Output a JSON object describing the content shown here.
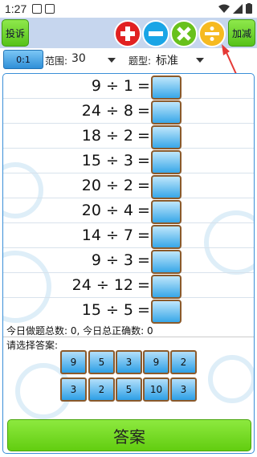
{
  "status_bar": {
    "time": "1:27"
  },
  "toolbar": {
    "complain_label": "投诉",
    "add_sub_label": "加减",
    "operators": [
      "plus",
      "minus",
      "times",
      "divide"
    ]
  },
  "settings": {
    "range_button_label": "0:1",
    "range_label": "范围:",
    "range_value": "30",
    "type_label": "题型:",
    "type_value": "标准"
  },
  "problems": [
    {
      "expr": "9 ÷ 1",
      "eq": "="
    },
    {
      "expr": "24 ÷ 8",
      "eq": "="
    },
    {
      "expr": "18 ÷ 2",
      "eq": "="
    },
    {
      "expr": "15 ÷ 3",
      "eq": "="
    },
    {
      "expr": "20 ÷ 2",
      "eq": "="
    },
    {
      "expr": "20 ÷ 4",
      "eq": "="
    },
    {
      "expr": "14 ÷ 7",
      "eq": "="
    },
    {
      "expr": "9 ÷ 3",
      "eq": "="
    },
    {
      "expr": "24 ÷ 12",
      "eq": "="
    },
    {
      "expr": "15 ÷ 5",
      "eq": "="
    }
  ],
  "stats_text": "今日做题总数: 0, 今日总正确数: 0",
  "prompt_text": "请选择答案:",
  "choices_row1": [
    "9",
    "5",
    "3",
    "9",
    "2"
  ],
  "choices_row2": [
    "3",
    "2",
    "5",
    "10",
    "3"
  ],
  "answer_button_label": "答案",
  "colors": {
    "toolbar_bg": "#c6d6ee",
    "green_button": "#62cd10",
    "blue_box": "#38a7e8",
    "box_border": "#8b5a2b",
    "plus": "#e12121",
    "minus": "#1aa5e6",
    "times": "#68c11c",
    "divide": "#f6ba21"
  }
}
